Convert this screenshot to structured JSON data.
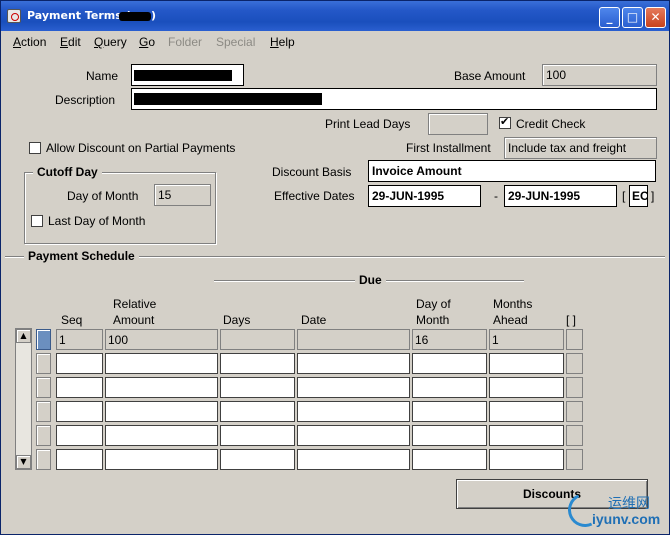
{
  "window": {
    "title": "Payment Terms (",
    "title_suffix": ")"
  },
  "titlebar_buttons": {
    "minimize": "_",
    "maximize": "□",
    "close": "✕"
  },
  "menu": [
    {
      "label": "Action",
      "mnemonic": "A",
      "rest": "ction",
      "enabled": true
    },
    {
      "label": "Edit",
      "mnemonic": "E",
      "rest": "dit",
      "enabled": true
    },
    {
      "label": "Query",
      "mnemonic": "Q",
      "rest": "uery",
      "enabled": true
    },
    {
      "label": "Go",
      "mnemonic": "G",
      "rest": "o",
      "enabled": true
    },
    {
      "label": "Folder",
      "mnemonic": "",
      "rest": "Folder",
      "enabled": false
    },
    {
      "label": "Special",
      "mnemonic": "",
      "rest": "Special",
      "enabled": false
    },
    {
      "label": "Help",
      "mnemonic": "H",
      "rest": "elp",
      "enabled": true
    }
  ],
  "header": {
    "name_label": "Name",
    "name_value": "",
    "base_amount_label": "Base Amount",
    "base_amount_value": "100",
    "description_label": "Description",
    "description_value": "",
    "print_lead_days_label": "Print Lead Days",
    "print_lead_days_value": "",
    "credit_check_label": "Credit Check",
    "credit_check_checked": true,
    "allow_discount_label": "Allow Discount on Partial Payments",
    "allow_discount_checked": false,
    "first_installment_label": "First Installment",
    "first_installment_value": "Include tax and freight",
    "discount_basis_label": "Discount Basis",
    "discount_basis_value": "Invoice Amount",
    "effective_dates_label": "Effective Dates",
    "effective_from": "29-JUN-1995",
    "date_separator": "-",
    "effective_to": "29-JUN-1995",
    "flex_open": "[",
    "flex_value": "EC",
    "flex_close": "]"
  },
  "cutoff": {
    "title": "Cutoff Day",
    "day_of_month_label": "Day of Month",
    "day_of_month_value": "15",
    "last_day_label": "Last Day of Month",
    "last_day_checked": false
  },
  "schedule": {
    "title": "Payment Schedule",
    "due_label": "Due",
    "columns": {
      "seq": "Seq",
      "relative_amount_1": "Relative",
      "relative_amount_2": "Amount",
      "days": "Days",
      "date": "Date",
      "day_of_month_1": "Day of",
      "day_of_month_2": "Month",
      "months_ahead_1": "Months",
      "months_ahead_2": "Ahead",
      "flex": "[ ]"
    },
    "rows": [
      {
        "seq": "1",
        "relative_amount": "100",
        "days": "",
        "date": "",
        "day_of_month": "16",
        "months_ahead": "1"
      },
      {
        "seq": "",
        "relative_amount": "",
        "days": "",
        "date": "",
        "day_of_month": "",
        "months_ahead": ""
      },
      {
        "seq": "",
        "relative_amount": "",
        "days": "",
        "date": "",
        "day_of_month": "",
        "months_ahead": ""
      },
      {
        "seq": "",
        "relative_amount": "",
        "days": "",
        "date": "",
        "day_of_month": "",
        "months_ahead": ""
      },
      {
        "seq": "",
        "relative_amount": "",
        "days": "",
        "date": "",
        "day_of_month": "",
        "months_ahead": ""
      },
      {
        "seq": "",
        "relative_amount": "",
        "days": "",
        "date": "",
        "day_of_month": "",
        "months_ahead": ""
      }
    ]
  },
  "buttons": {
    "discounts": "Discounts"
  },
  "watermark": {
    "cn": "运维网",
    "en": "iyunv.com"
  },
  "icons": {
    "app": "oracle-forms-icon",
    "scroll_up": "▲",
    "scroll_down": "▼"
  }
}
